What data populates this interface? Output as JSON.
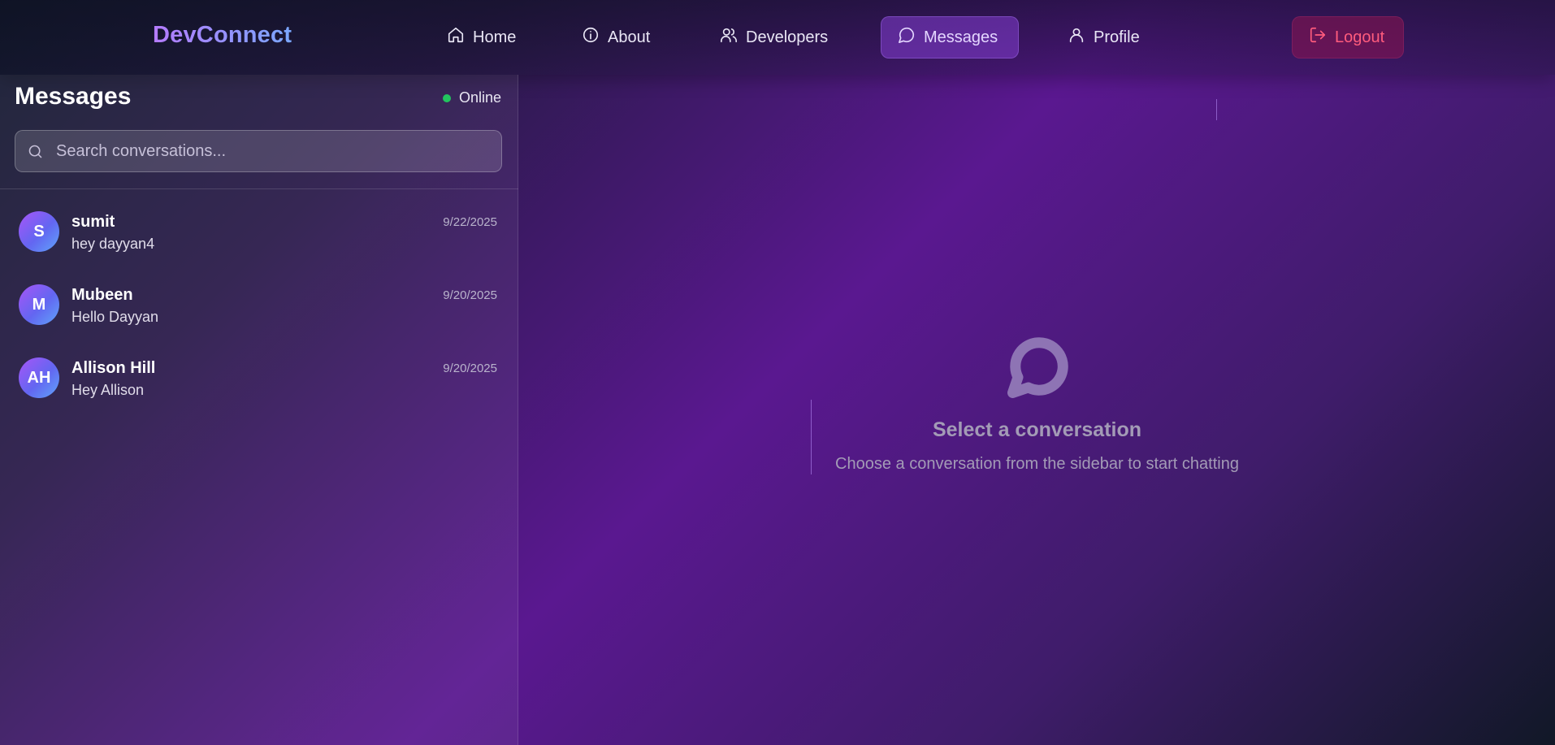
{
  "header": {
    "brand": "DevConnect",
    "nav": {
      "home": "Home",
      "about": "About",
      "developers": "Developers",
      "messages": "Messages",
      "profile": "Profile",
      "logout": "Logout"
    },
    "active_item": "Messages"
  },
  "sidebar": {
    "title": "Messages",
    "status": "Online",
    "search": {
      "placeholder": "Search conversations...",
      "value": ""
    },
    "conversations": [
      {
        "initials": "S",
        "name": "sumit",
        "date": "9/22/2025",
        "preview": "hey dayyan4"
      },
      {
        "initials": "M",
        "name": "Mubeen",
        "date": "9/20/2025",
        "preview": "Hello Dayyan"
      },
      {
        "initials": "AH",
        "name": "Allison Hill",
        "date": "9/20/2025",
        "preview": "Hey Allison"
      }
    ]
  },
  "main": {
    "empty_title": "Select a conversation",
    "empty_subtitle": "Choose a conversation from the sidebar to start chatting"
  },
  "colors": {
    "accent": "#843ed2",
    "online": "#22c55e",
    "logout": "#ff5c7d"
  }
}
